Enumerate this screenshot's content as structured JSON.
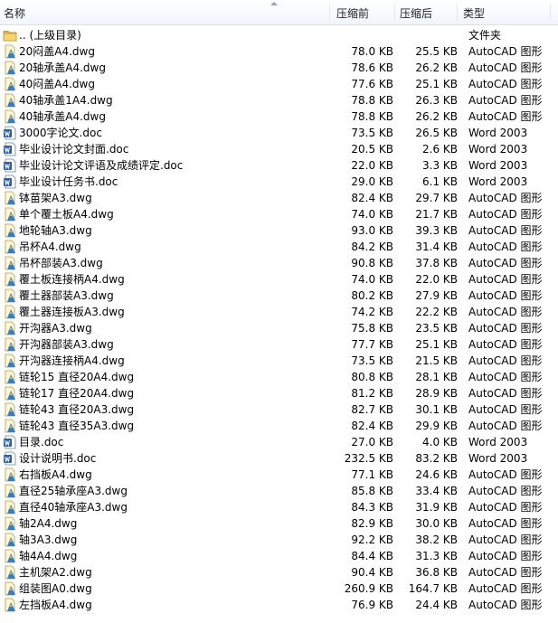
{
  "header": {
    "name": "名称",
    "original_size": "压缩前",
    "compressed_size": "压缩后",
    "type": "类型"
  },
  "files": [
    {
      "name": ".. (上级目录)",
      "orig": "",
      "comp": "",
      "type": "文件夹",
      "icon": "folder-icon"
    },
    {
      "name": "20闷盖A4.dwg",
      "orig": "78.0 KB",
      "comp": "25.5 KB",
      "type": "AutoCAD 图形",
      "icon": "autocad-file-icon"
    },
    {
      "name": "20轴承盖A4.dwg",
      "orig": "78.6 KB",
      "comp": "26.2 KB",
      "type": "AutoCAD 图形",
      "icon": "autocad-file-icon"
    },
    {
      "name": "40闷盖A4.dwg",
      "orig": "77.6 KB",
      "comp": "25.1 KB",
      "type": "AutoCAD 图形",
      "icon": "autocad-file-icon"
    },
    {
      "name": "40轴承盖1A4.dwg",
      "orig": "78.8 KB",
      "comp": "26.3 KB",
      "type": "AutoCAD 图形",
      "icon": "autocad-file-icon"
    },
    {
      "name": "40轴承盖A4.dwg",
      "orig": "78.8 KB",
      "comp": "26.2 KB",
      "type": "AutoCAD 图形",
      "icon": "autocad-file-icon"
    },
    {
      "name": "3000字论文.doc",
      "orig": "73.5 KB",
      "comp": "26.5 KB",
      "type": "Word 2003",
      "icon": "word-file-icon"
    },
    {
      "name": "毕业设计论文封面.doc",
      "orig": "20.5 KB",
      "comp": "2.6 KB",
      "type": "Word 2003",
      "icon": "word-file-icon"
    },
    {
      "name": "毕业设计论文评语及成绩评定.doc",
      "orig": "22.0 KB",
      "comp": "3.3 KB",
      "type": "Word 2003",
      "icon": "word-file-icon"
    },
    {
      "name": "毕业设计任务书.doc",
      "orig": "29.0 KB",
      "comp": "6.1 KB",
      "type": "Word 2003",
      "icon": "word-file-icon"
    },
    {
      "name": "钵苗架A3.dwg",
      "orig": "82.4 KB",
      "comp": "29.7 KB",
      "type": "AutoCAD 图形",
      "icon": "autocad-file-icon"
    },
    {
      "name": "单个覆土板A4.dwg",
      "orig": "74.0 KB",
      "comp": "21.7 KB",
      "type": "AutoCAD 图形",
      "icon": "autocad-file-icon"
    },
    {
      "name": "地轮轴A3.dwg",
      "orig": "93.0 KB",
      "comp": "39.3 KB",
      "type": "AutoCAD 图形",
      "icon": "autocad-file-icon"
    },
    {
      "name": "吊杯A4.dwg",
      "orig": "84.2 KB",
      "comp": "31.4 KB",
      "type": "AutoCAD 图形",
      "icon": "autocad-file-icon"
    },
    {
      "name": "吊杯部装A3.dwg",
      "orig": "90.8 KB",
      "comp": "37.8 KB",
      "type": "AutoCAD 图形",
      "icon": "autocad-file-icon"
    },
    {
      "name": "覆土板连接柄A4.dwg",
      "orig": "74.0 KB",
      "comp": "22.0 KB",
      "type": "AutoCAD 图形",
      "icon": "autocad-file-icon"
    },
    {
      "name": "覆土器部装A3.dwg",
      "orig": "80.2 KB",
      "comp": "27.9 KB",
      "type": "AutoCAD 图形",
      "icon": "autocad-file-icon"
    },
    {
      "name": "覆土器连接板A3.dwg",
      "orig": "74.2 KB",
      "comp": "22.2 KB",
      "type": "AutoCAD 图形",
      "icon": "autocad-file-icon"
    },
    {
      "name": "开沟器A3.dwg",
      "orig": "75.8 KB",
      "comp": "23.5 KB",
      "type": "AutoCAD 图形",
      "icon": "autocad-file-icon"
    },
    {
      "name": "开沟器部装A3.dwg",
      "orig": "77.7 KB",
      "comp": "25.1 KB",
      "type": "AutoCAD 图形",
      "icon": "autocad-file-icon"
    },
    {
      "name": "开沟器连接柄A4.dwg",
      "orig": "73.5 KB",
      "comp": "21.5 KB",
      "type": "AutoCAD 图形",
      "icon": "autocad-file-icon"
    },
    {
      "name": "链轮15 直径20A4.dwg",
      "orig": "80.8 KB",
      "comp": "28.1 KB",
      "type": "AutoCAD 图形",
      "icon": "autocad-file-icon"
    },
    {
      "name": "链轮17 直径20A4.dwg",
      "orig": "81.2 KB",
      "comp": "28.9 KB",
      "type": "AutoCAD 图形",
      "icon": "autocad-file-icon"
    },
    {
      "name": "链轮43 直径20A3.dwg",
      "orig": "82.7 KB",
      "comp": "30.1 KB",
      "type": "AutoCAD 图形",
      "icon": "autocad-file-icon"
    },
    {
      "name": "链轮43 直径35A3.dwg",
      "orig": "82.4 KB",
      "comp": "29.9 KB",
      "type": "AutoCAD 图形",
      "icon": "autocad-file-icon"
    },
    {
      "name": "目录.doc",
      "orig": "27.0 KB",
      "comp": "4.0 KB",
      "type": "Word 2003",
      "icon": "word-file-icon"
    },
    {
      "name": "设计说明书.doc",
      "orig": "232.5 KB",
      "comp": "83.2 KB",
      "type": "Word 2003",
      "icon": "word-file-icon"
    },
    {
      "name": "右挡板A4.dwg",
      "orig": "77.1 KB",
      "comp": "24.6 KB",
      "type": "AutoCAD 图形",
      "icon": "autocad-file-icon"
    },
    {
      "name": "直径25轴承座A3.dwg",
      "orig": "85.8 KB",
      "comp": "33.4 KB",
      "type": "AutoCAD 图形",
      "icon": "autocad-file-icon"
    },
    {
      "name": "直径40轴承座A3.dwg",
      "orig": "84.3 KB",
      "comp": "31.9 KB",
      "type": "AutoCAD 图形",
      "icon": "autocad-file-icon"
    },
    {
      "name": "轴2A4.dwg",
      "orig": "82.9 KB",
      "comp": "30.0 KB",
      "type": "AutoCAD 图形",
      "icon": "autocad-file-icon"
    },
    {
      "name": "轴3A3.dwg",
      "orig": "92.2 KB",
      "comp": "38.2 KB",
      "type": "AutoCAD 图形",
      "icon": "autocad-file-icon"
    },
    {
      "name": "轴4A4.dwg",
      "orig": "84.4 KB",
      "comp": "31.3 KB",
      "type": "AutoCAD 图形",
      "icon": "autocad-file-icon"
    },
    {
      "name": "主机架A2.dwg",
      "orig": "90.4 KB",
      "comp": "36.8 KB",
      "type": "AutoCAD 图形",
      "icon": "autocad-file-icon"
    },
    {
      "name": "组装图A0.dwg",
      "orig": "260.9 KB",
      "comp": "164.7 KB",
      "type": "AutoCAD 图形",
      "icon": "autocad-file-icon"
    },
    {
      "name": "左挡板A4.dwg",
      "orig": "76.9 KB",
      "comp": "24.4 KB",
      "type": "AutoCAD 图形",
      "icon": "autocad-file-icon"
    }
  ]
}
